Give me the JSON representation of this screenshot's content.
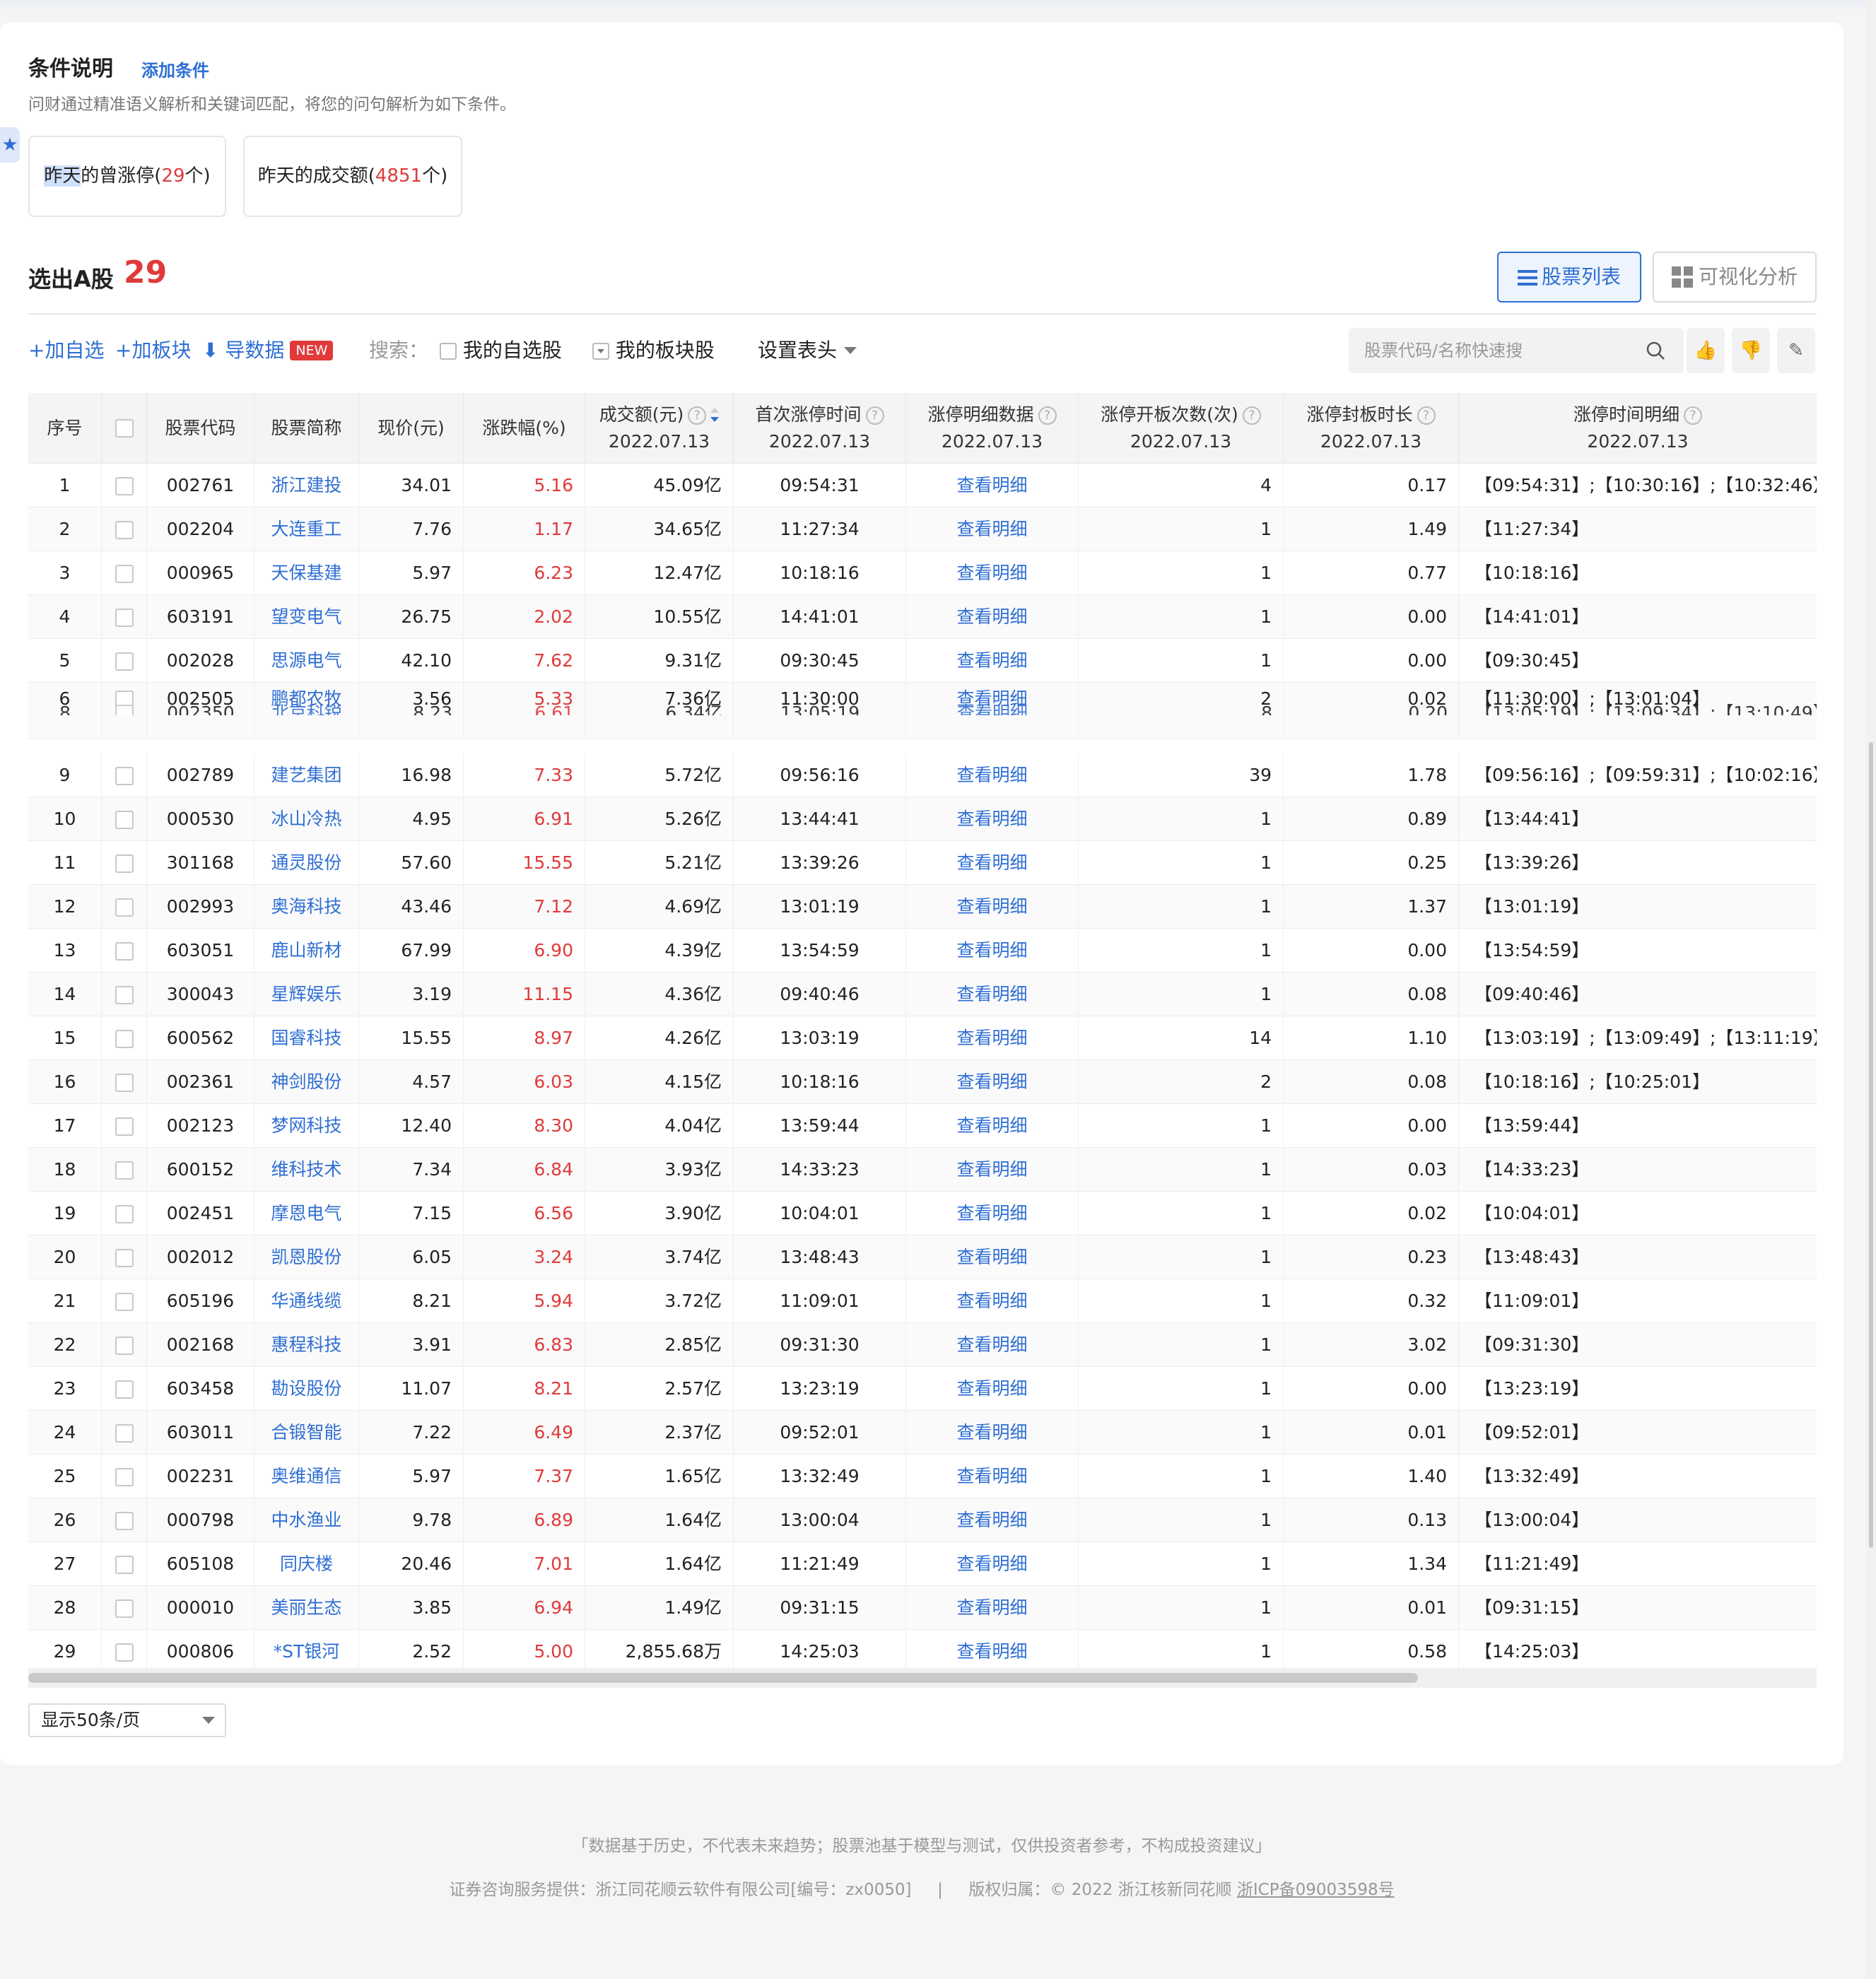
{
  "conditions": {
    "title": "条件说明",
    "add_label": "添加条件",
    "description": "问财通过精准语义解析和关键词匹配，将您的问句解析为如下条件。",
    "items": [
      {
        "highlight": "昨天",
        "label": "的曾涨停(",
        "count": "29",
        "suffix": "个)"
      },
      {
        "highlight": "",
        "label": "昨天的成交额(",
        "count": "4851",
        "suffix": "个)"
      }
    ]
  },
  "result": {
    "title": "选出A股",
    "count": "29",
    "view_list_label": "股票列表",
    "view_visual_label": "可视化分析"
  },
  "toolbar": {
    "add_watch": "+加自选",
    "add_block": "+加板块",
    "export": "导数据",
    "new_badge": "NEW",
    "search_label": "搜索：",
    "my_watchlist": "我的自选股",
    "my_blocks": "我的板块股",
    "set_header": "设置表头",
    "search_placeholder": "股票代码/名称快速搜"
  },
  "table": {
    "headers": [
      {
        "label": "序号"
      },
      {
        "label": ""
      },
      {
        "label": "股票代码"
      },
      {
        "label": "股票简称"
      },
      {
        "label": "现价(元)"
      },
      {
        "label": "涨跌幅(%)"
      },
      {
        "label": "成交额(元)",
        "date": "2022.07.13"
      },
      {
        "label": "首次涨停时间",
        "date": "2022.07.13"
      },
      {
        "label": "涨停明细数据",
        "date": "2022.07.13"
      },
      {
        "label": "涨停开板次数(次)",
        "date": "2022.07.13"
      },
      {
        "label": "涨停封板时长",
        "date": "2022.07.13"
      },
      {
        "label": "涨停时间明细",
        "date": "2022.07.13"
      }
    ],
    "detail_link": "查看明细",
    "rows": [
      {
        "no": "1",
        "code": "002761",
        "name": "浙江建投",
        "price": "34.01",
        "chg": "5.16",
        "amount": "45.09亿",
        "first": "09:54:31",
        "opens": "4",
        "dur": "0.17",
        "times": "【09:54:31】;【10:30:16】;【10:32:46】;"
      },
      {
        "no": "2",
        "code": "002204",
        "name": "大连重工",
        "price": "7.76",
        "chg": "1.17",
        "amount": "34.65亿",
        "first": "11:27:34",
        "opens": "1",
        "dur": "1.49",
        "times": "【11:27:34】"
      },
      {
        "no": "3",
        "code": "000965",
        "name": "天保基建",
        "price": "5.97",
        "chg": "6.23",
        "amount": "12.47亿",
        "first": "10:18:16",
        "opens": "1",
        "dur": "0.77",
        "times": "【10:18:16】"
      },
      {
        "no": "4",
        "code": "603191",
        "name": "望变电气",
        "price": "26.75",
        "chg": "2.02",
        "amount": "10.55亿",
        "first": "14:41:01",
        "opens": "1",
        "dur": "0.00",
        "times": "【14:41:01】"
      },
      {
        "no": "5",
        "code": "002028",
        "name": "思源电气",
        "price": "42.10",
        "chg": "7.62",
        "amount": "9.31亿",
        "first": "09:30:45",
        "opens": "1",
        "dur": "0.00",
        "times": "【09:30:45】"
      },
      {
        "no": "6",
        "code": "002505",
        "name": "鹏都农牧",
        "price": "3.56",
        "chg": "5.33",
        "amount": "7.36亿",
        "first": "11:30:00",
        "opens": "2",
        "dur": "0.02",
        "times": "【11:30:00】;【13:01:04】"
      },
      {
        "no": "9",
        "code": "002789",
        "name": "建艺集团",
        "price": "16.98",
        "chg": "7.33",
        "amount": "5.72亿",
        "first": "09:56:16",
        "opens": "39",
        "dur": "1.78",
        "times": "【09:56:16】;【09:59:31】;【10:02:16】;"
      },
      {
        "no": "10",
        "code": "000530",
        "name": "冰山冷热",
        "price": "4.95",
        "chg": "6.91",
        "amount": "5.26亿",
        "first": "13:44:41",
        "opens": "1",
        "dur": "0.89",
        "times": "【13:44:41】"
      },
      {
        "no": "11",
        "code": "301168",
        "name": "通灵股份",
        "price": "57.60",
        "chg": "15.55",
        "amount": "5.21亿",
        "first": "13:39:26",
        "opens": "1",
        "dur": "0.25",
        "times": "【13:39:26】"
      },
      {
        "no": "12",
        "code": "002993",
        "name": "奥海科技",
        "price": "43.46",
        "chg": "7.12",
        "amount": "4.69亿",
        "first": "13:01:19",
        "opens": "1",
        "dur": "1.37",
        "times": "【13:01:19】"
      },
      {
        "no": "13",
        "code": "603051",
        "name": "鹿山新材",
        "price": "67.99",
        "chg": "6.90",
        "amount": "4.39亿",
        "first": "13:54:59",
        "opens": "1",
        "dur": "0.00",
        "times": "【13:54:59】"
      },
      {
        "no": "14",
        "code": "300043",
        "name": "星辉娱乐",
        "price": "3.19",
        "chg": "11.15",
        "amount": "4.36亿",
        "first": "09:40:46",
        "opens": "1",
        "dur": "0.08",
        "times": "【09:40:46】"
      },
      {
        "no": "15",
        "code": "600562",
        "name": "国睿科技",
        "price": "15.55",
        "chg": "8.97",
        "amount": "4.26亿",
        "first": "13:03:19",
        "opens": "14",
        "dur": "1.10",
        "times": "【13:03:19】;【13:09:49】;【13:11:19】;"
      },
      {
        "no": "16",
        "code": "002361",
        "name": "神剑股份",
        "price": "4.57",
        "chg": "6.03",
        "amount": "4.15亿",
        "first": "10:18:16",
        "opens": "2",
        "dur": "0.08",
        "times": "【10:18:16】;【10:25:01】"
      },
      {
        "no": "17",
        "code": "002123",
        "name": "梦网科技",
        "price": "12.40",
        "chg": "8.30",
        "amount": "4.04亿",
        "first": "13:59:44",
        "opens": "1",
        "dur": "0.00",
        "times": "【13:59:44】"
      },
      {
        "no": "18",
        "code": "600152",
        "name": "维科技术",
        "price": "7.34",
        "chg": "6.84",
        "amount": "3.93亿",
        "first": "14:33:23",
        "opens": "1",
        "dur": "0.03",
        "times": "【14:33:23】"
      },
      {
        "no": "19",
        "code": "002451",
        "name": "摩恩电气",
        "price": "7.15",
        "chg": "6.56",
        "amount": "3.90亿",
        "first": "10:04:01",
        "opens": "1",
        "dur": "0.02",
        "times": "【10:04:01】"
      },
      {
        "no": "20",
        "code": "002012",
        "name": "凯恩股份",
        "price": "6.05",
        "chg": "3.24",
        "amount": "3.74亿",
        "first": "13:48:43",
        "opens": "1",
        "dur": "0.23",
        "times": "【13:48:43】"
      },
      {
        "no": "21",
        "code": "605196",
        "name": "华通线缆",
        "price": "8.21",
        "chg": "5.94",
        "amount": "3.72亿",
        "first": "11:09:01",
        "opens": "1",
        "dur": "0.32",
        "times": "【11:09:01】"
      },
      {
        "no": "22",
        "code": "002168",
        "name": "惠程科技",
        "price": "3.91",
        "chg": "6.83",
        "amount": "2.85亿",
        "first": "09:31:30",
        "opens": "1",
        "dur": "3.02",
        "times": "【09:31:30】"
      },
      {
        "no": "23",
        "code": "603458",
        "name": "勘设股份",
        "price": "11.07",
        "chg": "8.21",
        "amount": "2.57亿",
        "first": "13:23:19",
        "opens": "1",
        "dur": "0.00",
        "times": "【13:23:19】"
      },
      {
        "no": "24",
        "code": "603011",
        "name": "合锻智能",
        "price": "7.22",
        "chg": "6.49",
        "amount": "2.37亿",
        "first": "09:52:01",
        "opens": "1",
        "dur": "0.01",
        "times": "【09:52:01】"
      },
      {
        "no": "25",
        "code": "002231",
        "name": "奥维通信",
        "price": "5.97",
        "chg": "7.37",
        "amount": "1.65亿",
        "first": "13:32:49",
        "opens": "1",
        "dur": "1.40",
        "times": "【13:32:49】"
      },
      {
        "no": "26",
        "code": "000798",
        "name": "中水渔业",
        "price": "9.78",
        "chg": "6.89",
        "amount": "1.64亿",
        "first": "13:00:04",
        "opens": "1",
        "dur": "0.13",
        "times": "【13:00:04】"
      },
      {
        "no": "27",
        "code": "605108",
        "name": "同庆楼",
        "price": "20.46",
        "chg": "7.01",
        "amount": "1.64亿",
        "first": "11:21:49",
        "opens": "1",
        "dur": "1.34",
        "times": "【11:21:49】"
      },
      {
        "no": "28",
        "code": "000010",
        "name": "美丽生态",
        "price": "3.85",
        "chg": "6.94",
        "amount": "1.49亿",
        "first": "09:31:15",
        "opens": "1",
        "dur": "0.01",
        "times": "【09:31:15】"
      },
      {
        "no": "29",
        "code": "000806",
        "name": "*ST银河",
        "price": "2.52",
        "chg": "5.00",
        "amount": "2,855.68万",
        "first": "14:25:03",
        "opens": "1",
        "dur": "0.58",
        "times": "【14:25:03】"
      }
    ],
    "overlap_row": {
      "no": "8",
      "code": "002350",
      "name": "北京科锐",
      "price": "8.23",
      "chg": "6.61",
      "amount": "6.34亿",
      "first": "13:05:19",
      "opens": "8",
      "dur": "0.20",
      "times": "【13:05:19】;【13:09:34】;【13:10:49】;"
    }
  },
  "pager": {
    "label": "显示50条/页"
  },
  "footer": {
    "disclaimer": "「数据基于历史，不代表未来趋势；股票池基于模型与测试，仅供投资者参考，不构成投资建议」",
    "provider": "证券咨询服务提供：浙江同花顺云软件有限公司[编号：zx0050]",
    "separator": "|",
    "copyright": "版权归属：© 2022 浙江核新同花顺",
    "icp": "浙ICP备09003598号"
  },
  "colors": {
    "accent": "#2f6fd3",
    "up": "#e03a3a"
  }
}
